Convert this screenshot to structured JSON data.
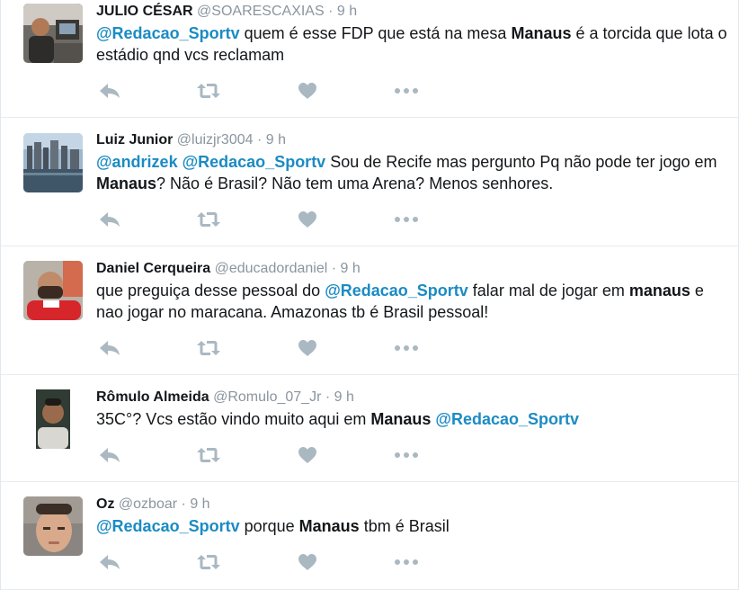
{
  "colors": {
    "link": "#1b8bc4",
    "meta": "#8a959e",
    "icon": "#aab8c2",
    "divider": "#e6ecf0"
  },
  "tweets": [
    {
      "fullname": "JULIO CÉSAR",
      "username": "@SOARESCAXIAS",
      "dot": "·",
      "time": "9 h",
      "segments": [
        {
          "t": "m",
          "v": "@Redacao_Sportv"
        },
        {
          "t": "n",
          "v": " quem é esse FDP que está na mesa "
        },
        {
          "t": "b",
          "v": "Manaus"
        },
        {
          "t": "n",
          "v": " é a torcida que lota o estádio qnd vcs reclamam"
        }
      ]
    },
    {
      "fullname": "Luiz Junior",
      "username": "@luizjr3004",
      "dot": "·",
      "time": "9 h",
      "segments": [
        {
          "t": "n",
          "v": "@andrizek "
        },
        {
          "t": "m",
          "v": "@Redacao_Sportv"
        },
        {
          "t": "n",
          "v": " Sou de Recife mas pergunto Pq não pode ter jogo em "
        },
        {
          "t": "b",
          "v": "Manaus"
        },
        {
          "t": "n",
          "v": "? Não é Brasil? Não tem uma Arena? Menos senhores."
        }
      ]
    },
    {
      "fullname": "Daniel Cerqueira",
      "username": "@educadordaniel",
      "dot": "·",
      "time": "9 h",
      "segments": [
        {
          "t": "n",
          "v": "que preguiça desse pessoal do "
        },
        {
          "t": "m",
          "v": "@Redacao_Sportv"
        },
        {
          "t": "n",
          "v": " falar mal de jogar em "
        },
        {
          "t": "b",
          "v": "manaus"
        },
        {
          "t": "n",
          "v": " e nao jogar no maracana. Amazonas tb é Brasil pessoal!"
        }
      ]
    },
    {
      "fullname": "Rômulo Almeida",
      "username": "@Romulo_07_Jr",
      "dot": "·",
      "time": "9 h",
      "segments": [
        {
          "t": "n",
          "v": "35C°? Vcs estão vindo muito aqui em "
        },
        {
          "t": "b",
          "v": "Manaus"
        },
        {
          "t": "n",
          "v": " "
        },
        {
          "t": "m",
          "v": "@Redacao_Sportv"
        }
      ]
    },
    {
      "fullname": "Oz",
      "username": "@ozboar",
      "dot": "·",
      "time": "9 h",
      "segments": [
        {
          "t": "m",
          "v": "@Redacao_Sportv"
        },
        {
          "t": "n",
          "v": " porque "
        },
        {
          "t": "b",
          "v": "Manaus"
        },
        {
          "t": "n",
          "v": " tbm é Brasil"
        }
      ]
    }
  ],
  "actions": [
    "reply-icon",
    "retweet-icon",
    "like-icon",
    "more-icon"
  ]
}
